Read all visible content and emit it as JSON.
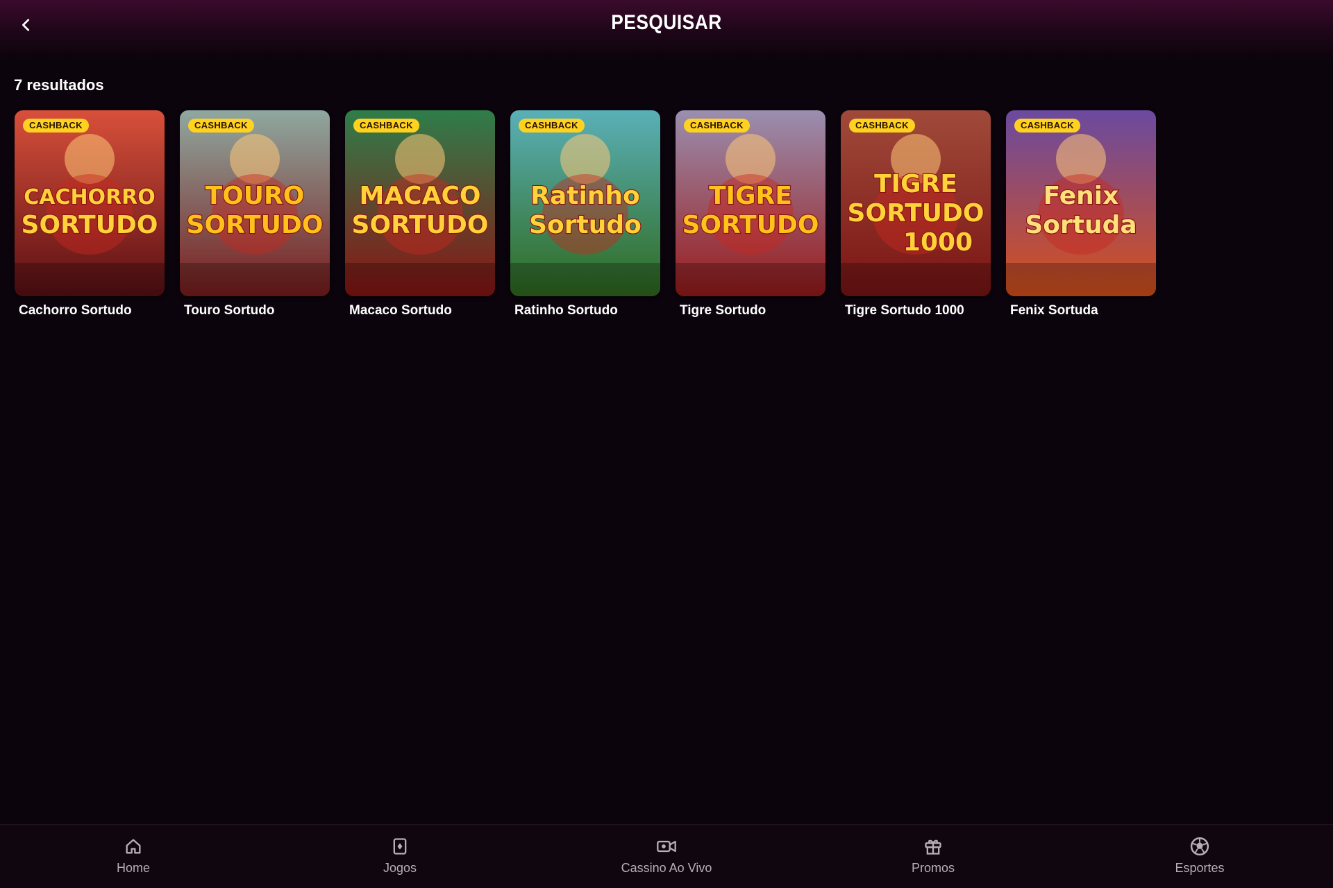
{
  "header": {
    "title": "PESQUISAR",
    "back_icon": "chevron-left-icon"
  },
  "results": {
    "count_label": "7 resultados",
    "games": [
      {
        "name": "Cachorro Sortudo",
        "badge": "CASHBACK",
        "logo_line1": "CACHORRO",
        "logo_line2": "SORTUDO",
        "logo_line3": "",
        "bg_top": "#d8503a",
        "bg_bottom": "#5a0f14",
        "logo_color": "#ffd23a"
      },
      {
        "name": "Touro Sortudo",
        "badge": "CASHBACK",
        "logo_line1": "TOURO",
        "logo_line2": "SORTUDO",
        "logo_line3": "",
        "bg_top": "#8fa8a0",
        "bg_bottom": "#7a1c1c",
        "logo_color": "#ffc21a"
      },
      {
        "name": "Macaco Sortudo",
        "badge": "CASHBACK",
        "logo_line1": "MACACO",
        "logo_line2": "SORTUDO",
        "logo_line3": "",
        "bg_top": "#2f7d4a",
        "bg_bottom": "#8a1414",
        "logo_color": "#ffd23a"
      },
      {
        "name": "Ratinho Sortudo",
        "badge": "CASHBACK",
        "logo_line1": "Ratinho",
        "logo_line2": "Sortudo",
        "logo_line3": "",
        "bg_top": "#5ab0b8",
        "bg_bottom": "#2f6a1e",
        "logo_color": "#ffd23a"
      },
      {
        "name": "Tigre Sortudo",
        "badge": "CASHBACK",
        "logo_line1": "TIGRE",
        "logo_line2": "SORTUDO",
        "logo_line3": "",
        "bg_top": "#9a8fb0",
        "bg_bottom": "#9a1a1a",
        "logo_color": "#ffc21a"
      },
      {
        "name": "Tigre Sortudo 1000",
        "badge": "CASHBACK",
        "logo_line1": "TIGRE",
        "logo_line2": "SORTUDO",
        "logo_line3": "1000",
        "bg_top": "#a04a3a",
        "bg_bottom": "#7a1414",
        "logo_color": "#ffd23a"
      },
      {
        "name": "Fenix Sortuda",
        "badge": "CASHBACK",
        "logo_line1": "Fenix",
        "logo_line2": "Sortuda",
        "logo_line3": "",
        "bg_top": "#6a4aa0",
        "bg_bottom": "#d8501a",
        "logo_color": "#ffe07a"
      }
    ]
  },
  "bottom_nav": {
    "items": [
      {
        "label": "Home",
        "icon": "home-icon"
      },
      {
        "label": "Jogos",
        "icon": "cards-icon"
      },
      {
        "label": "Cassino Ao Vivo",
        "icon": "video-camera-icon"
      },
      {
        "label": "Promos",
        "icon": "gift-icon"
      },
      {
        "label": "Esportes",
        "icon": "soccer-ball-icon"
      }
    ]
  }
}
